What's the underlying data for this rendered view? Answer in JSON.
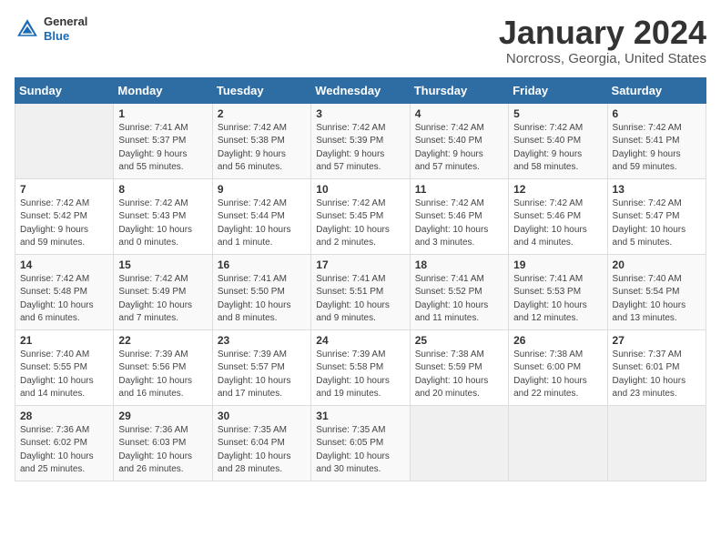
{
  "header": {
    "logo_general": "General",
    "logo_blue": "Blue",
    "month_title": "January 2024",
    "location": "Norcross, Georgia, United States"
  },
  "weekdays": [
    "Sunday",
    "Monday",
    "Tuesday",
    "Wednesday",
    "Thursday",
    "Friday",
    "Saturday"
  ],
  "weeks": [
    [
      {
        "num": "",
        "info": ""
      },
      {
        "num": "1",
        "info": "Sunrise: 7:41 AM\nSunset: 5:37 PM\nDaylight: 9 hours\nand 55 minutes."
      },
      {
        "num": "2",
        "info": "Sunrise: 7:42 AM\nSunset: 5:38 PM\nDaylight: 9 hours\nand 56 minutes."
      },
      {
        "num": "3",
        "info": "Sunrise: 7:42 AM\nSunset: 5:39 PM\nDaylight: 9 hours\nand 57 minutes."
      },
      {
        "num": "4",
        "info": "Sunrise: 7:42 AM\nSunset: 5:40 PM\nDaylight: 9 hours\nand 57 minutes."
      },
      {
        "num": "5",
        "info": "Sunrise: 7:42 AM\nSunset: 5:40 PM\nDaylight: 9 hours\nand 58 minutes."
      },
      {
        "num": "6",
        "info": "Sunrise: 7:42 AM\nSunset: 5:41 PM\nDaylight: 9 hours\nand 59 minutes."
      }
    ],
    [
      {
        "num": "7",
        "info": "Sunrise: 7:42 AM\nSunset: 5:42 PM\nDaylight: 9 hours\nand 59 minutes."
      },
      {
        "num": "8",
        "info": "Sunrise: 7:42 AM\nSunset: 5:43 PM\nDaylight: 10 hours\nand 0 minutes."
      },
      {
        "num": "9",
        "info": "Sunrise: 7:42 AM\nSunset: 5:44 PM\nDaylight: 10 hours\nand 1 minute."
      },
      {
        "num": "10",
        "info": "Sunrise: 7:42 AM\nSunset: 5:45 PM\nDaylight: 10 hours\nand 2 minutes."
      },
      {
        "num": "11",
        "info": "Sunrise: 7:42 AM\nSunset: 5:46 PM\nDaylight: 10 hours\nand 3 minutes."
      },
      {
        "num": "12",
        "info": "Sunrise: 7:42 AM\nSunset: 5:46 PM\nDaylight: 10 hours\nand 4 minutes."
      },
      {
        "num": "13",
        "info": "Sunrise: 7:42 AM\nSunset: 5:47 PM\nDaylight: 10 hours\nand 5 minutes."
      }
    ],
    [
      {
        "num": "14",
        "info": "Sunrise: 7:42 AM\nSunset: 5:48 PM\nDaylight: 10 hours\nand 6 minutes."
      },
      {
        "num": "15",
        "info": "Sunrise: 7:42 AM\nSunset: 5:49 PM\nDaylight: 10 hours\nand 7 minutes."
      },
      {
        "num": "16",
        "info": "Sunrise: 7:41 AM\nSunset: 5:50 PM\nDaylight: 10 hours\nand 8 minutes."
      },
      {
        "num": "17",
        "info": "Sunrise: 7:41 AM\nSunset: 5:51 PM\nDaylight: 10 hours\nand 9 minutes."
      },
      {
        "num": "18",
        "info": "Sunrise: 7:41 AM\nSunset: 5:52 PM\nDaylight: 10 hours\nand 11 minutes."
      },
      {
        "num": "19",
        "info": "Sunrise: 7:41 AM\nSunset: 5:53 PM\nDaylight: 10 hours\nand 12 minutes."
      },
      {
        "num": "20",
        "info": "Sunrise: 7:40 AM\nSunset: 5:54 PM\nDaylight: 10 hours\nand 13 minutes."
      }
    ],
    [
      {
        "num": "21",
        "info": "Sunrise: 7:40 AM\nSunset: 5:55 PM\nDaylight: 10 hours\nand 14 minutes."
      },
      {
        "num": "22",
        "info": "Sunrise: 7:39 AM\nSunset: 5:56 PM\nDaylight: 10 hours\nand 16 minutes."
      },
      {
        "num": "23",
        "info": "Sunrise: 7:39 AM\nSunset: 5:57 PM\nDaylight: 10 hours\nand 17 minutes."
      },
      {
        "num": "24",
        "info": "Sunrise: 7:39 AM\nSunset: 5:58 PM\nDaylight: 10 hours\nand 19 minutes."
      },
      {
        "num": "25",
        "info": "Sunrise: 7:38 AM\nSunset: 5:59 PM\nDaylight: 10 hours\nand 20 minutes."
      },
      {
        "num": "26",
        "info": "Sunrise: 7:38 AM\nSunset: 6:00 PM\nDaylight: 10 hours\nand 22 minutes."
      },
      {
        "num": "27",
        "info": "Sunrise: 7:37 AM\nSunset: 6:01 PM\nDaylight: 10 hours\nand 23 minutes."
      }
    ],
    [
      {
        "num": "28",
        "info": "Sunrise: 7:36 AM\nSunset: 6:02 PM\nDaylight: 10 hours\nand 25 minutes."
      },
      {
        "num": "29",
        "info": "Sunrise: 7:36 AM\nSunset: 6:03 PM\nDaylight: 10 hours\nand 26 minutes."
      },
      {
        "num": "30",
        "info": "Sunrise: 7:35 AM\nSunset: 6:04 PM\nDaylight: 10 hours\nand 28 minutes."
      },
      {
        "num": "31",
        "info": "Sunrise: 7:35 AM\nSunset: 6:05 PM\nDaylight: 10 hours\nand 30 minutes."
      },
      {
        "num": "",
        "info": ""
      },
      {
        "num": "",
        "info": ""
      },
      {
        "num": "",
        "info": ""
      }
    ]
  ]
}
